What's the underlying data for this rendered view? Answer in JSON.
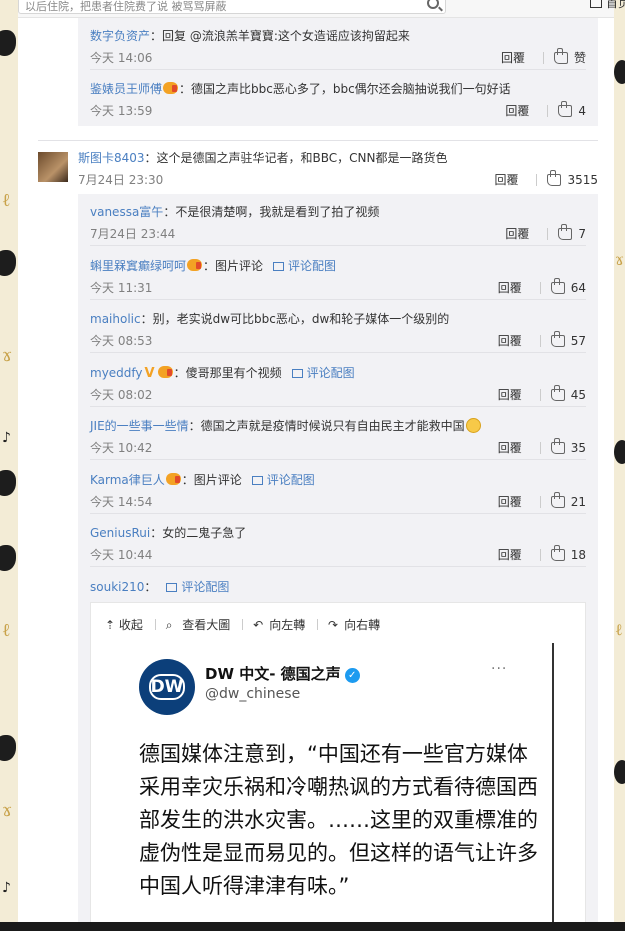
{
  "search": {
    "query": "以后住院，把患者住院费了说 被骂骂屏蔽"
  },
  "topbar": {
    "home_label": "首页"
  },
  "replies_top": [
    {
      "user": "数字负资产",
      "text": "：回复 @流浪羔羊寶寶:这个女造谣应该拘留起来",
      "time": "今天 14:06",
      "reply": "回覆",
      "likes": "赞"
    },
    {
      "user": "鉴婊员王师傅",
      "text": "：德国之声比bbc恶心多了，bbc偶尔还会脑抽说我们一句好话",
      "time": "今天 13:59",
      "reply": "回覆",
      "likes": "4"
    }
  ],
  "main_comment": {
    "user": "斯图卡8403",
    "text": "：这个是德国之声驻华记者，和BBC，CNN都是一路货色",
    "time": "7月24日 23:30",
    "reply": "回覆",
    "likes": "3515"
  },
  "replies": [
    {
      "user": "vanessa富午",
      "text": "：不是很清楚啊，我就是看到了拍了视频",
      "time": "7月24日 23:44",
      "reply": "回覆",
      "likes": "7"
    },
    {
      "user": "蝌里槑窴癫绿呵呵",
      "text": "：图片评论",
      "pic_link": "评论配图",
      "time": "今天 11:31",
      "reply": "回覆",
      "likes": "64"
    },
    {
      "user": "maiholic",
      "text": "：别，老实说dw可比bbc恶心，dw和轮子媒体一个级别的",
      "time": "今天 08:53",
      "reply": "回覆",
      "likes": "57"
    },
    {
      "user": "myeddfy",
      "text": "：傻哥那里有个视频",
      "pic_link": "评论配图",
      "time": "今天 08:02",
      "reply": "回覆",
      "likes": "45"
    },
    {
      "user": "JIE的一些事一些情",
      "text": "：德国之声就是疫情时候说只有自由民主才能救中国",
      "time": "今天 10:42",
      "reply": "回覆",
      "likes": "35"
    },
    {
      "user": "Karma律巨人",
      "text": "：图片评论",
      "pic_link": "评论配图",
      "time": "今天 14:54",
      "reply": "回覆",
      "likes": "21"
    },
    {
      "user": "GeniusRui",
      "text": "：女的二鬼子急了",
      "time": "今天 10:44",
      "reply": "回覆",
      "likes": "18"
    }
  ],
  "last_reply": {
    "user": "souki210",
    "text": "：",
    "pic_link": "评论配图"
  },
  "viewer": {
    "collapse": "收起",
    "view_large": "查看大圖",
    "rotate_left": "向左轉",
    "rotate_right": "向右轉"
  },
  "tweet": {
    "logo": "DW",
    "name": "DW 中文- 德国之声",
    "handle": "@dw_chinese",
    "more": "···",
    "body": "德国媒体注意到，“中国还有一些官方媒体采用幸灾乐祸和冷嘲热讽的方式看待德国西部发生的洪水灾害。……这里的双重標准的虚伪性是显而易见的。但这样的语气让许多中国人听得津津有味。”"
  }
}
